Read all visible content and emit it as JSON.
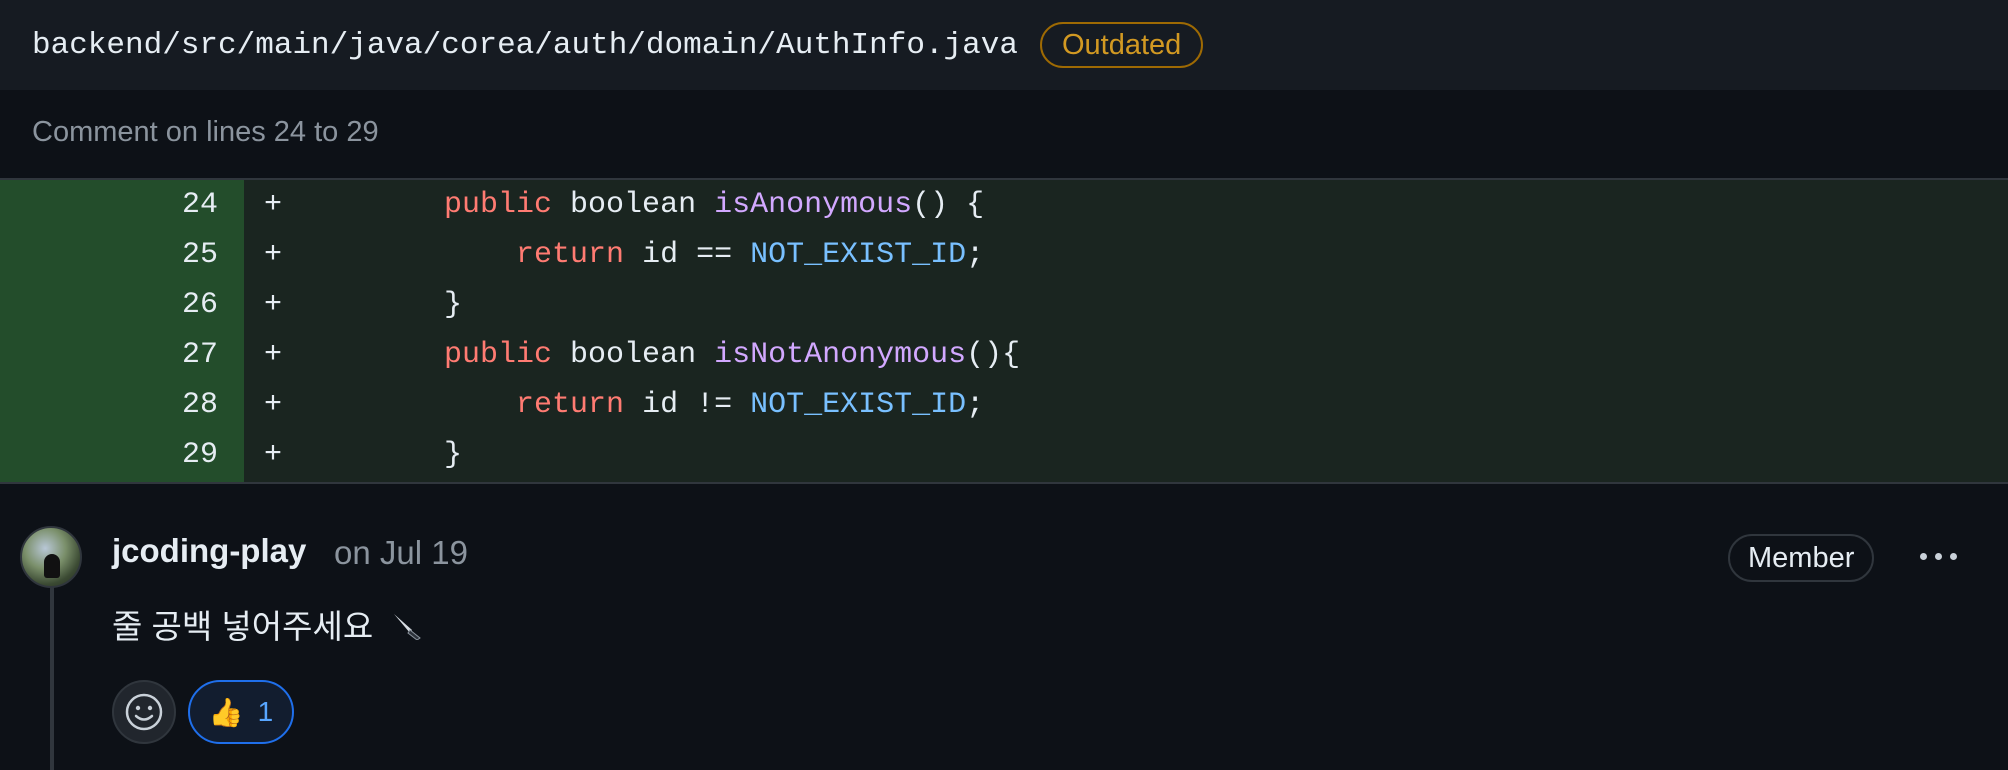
{
  "file": {
    "path": "backend/src/main/java/corea/auth/domain/AuthInfo.java",
    "status_badge": "Outdated"
  },
  "comment_range": "Comment on lines 24 to 29",
  "diff": {
    "lines": [
      {
        "num": "24",
        "sign": "+",
        "tokens": [
          [
            "plain",
            "    "
          ],
          [
            "kw",
            "public"
          ],
          [
            "plain",
            " boolean "
          ],
          [
            "fn",
            "isAnonymous"
          ],
          [
            "plain",
            "() {"
          ]
        ]
      },
      {
        "num": "25",
        "sign": "+",
        "tokens": [
          [
            "plain",
            "        "
          ],
          [
            "kw",
            "return"
          ],
          [
            "plain",
            " id == "
          ],
          [
            "const",
            "NOT_EXIST_ID"
          ],
          [
            "plain",
            ";"
          ]
        ]
      },
      {
        "num": "26",
        "sign": "+",
        "tokens": [
          [
            "plain",
            "    }"
          ]
        ]
      },
      {
        "num": "27",
        "sign": "+",
        "tokens": [
          [
            "plain",
            "    "
          ],
          [
            "kw",
            "public"
          ],
          [
            "plain",
            " boolean "
          ],
          [
            "fn",
            "isNotAnonymous"
          ],
          [
            "plain",
            "(){"
          ]
        ]
      },
      {
        "num": "28",
        "sign": "+",
        "tokens": [
          [
            "plain",
            "        "
          ],
          [
            "kw",
            "return"
          ],
          [
            "plain",
            " id != "
          ],
          [
            "const",
            "NOT_EXIST_ID"
          ],
          [
            "plain",
            ";"
          ]
        ]
      },
      {
        "num": "29",
        "sign": "+",
        "tokens": [
          [
            "plain",
            "    }"
          ]
        ]
      }
    ]
  },
  "comment": {
    "author": "jcoding-play",
    "date": "on Jul 19",
    "role_badge": "Member",
    "body": "줄 공백 넣어주세요",
    "body_icon": "knife-icon",
    "reactions": [
      {
        "emoji": "👍",
        "count": "1"
      }
    ]
  },
  "colors": {
    "background": "#0d1117",
    "header_bg": "#161b22",
    "added_gutter": "#234d2b",
    "added_line": "#1a2520",
    "keyword": "#ff7b72",
    "function": "#d2a8ff",
    "constant": "#79c0ff",
    "outdated": "#d29922",
    "accent": "#1f6feb"
  }
}
